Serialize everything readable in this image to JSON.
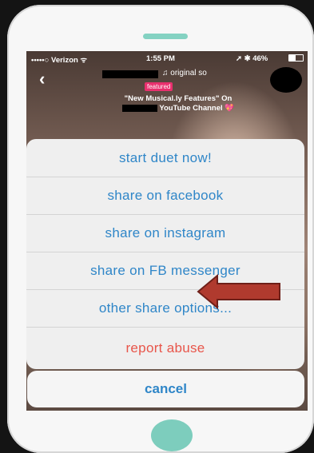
{
  "status_bar": {
    "carrier": "•••••○ Verizon ᯤ",
    "time": "1:55 PM",
    "battery": "➚ ✱ 46%"
  },
  "video": {
    "song": "♫ original so",
    "badge": "featured",
    "caption_line1": "\"New Musical.ly Features\" On",
    "caption_line2": "YouTube Channel",
    "heart": "💖"
  },
  "menu": {
    "items": [
      {
        "label": "start duet now!"
      },
      {
        "label": "share on facebook"
      },
      {
        "label": "share on instagram"
      },
      {
        "label": "share on FB messenger"
      },
      {
        "label": "other share options..."
      },
      {
        "label": "report abuse"
      }
    ],
    "cancel": "cancel"
  },
  "colors": {
    "accent": "#2f86c8",
    "danger": "#e8554a",
    "annotation_arrow": "#b03a2e",
    "phone_accent": "#7dcdbd"
  }
}
